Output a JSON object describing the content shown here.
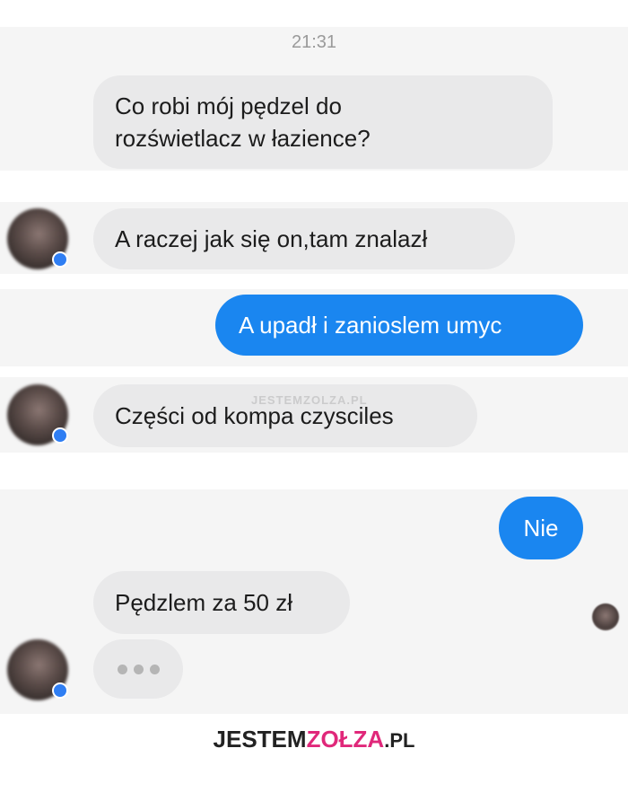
{
  "conversation": {
    "timestamp": "21:31",
    "messages": [
      {
        "from": "me",
        "text": "Co robi mój pędzel do rozświetlacz w łazience?"
      },
      {
        "from": "contact",
        "text": "A raczej jak się on,tam znalazł"
      },
      {
        "from": "me",
        "text": "A upadł i zanioslem umyc"
      },
      {
        "from": "contact",
        "text": "Części od kompa czysciles"
      },
      {
        "from": "me",
        "text": "Nie"
      },
      {
        "from": "contact",
        "text": "Pędzlem za 50 zł"
      }
    ],
    "typing_indicator": "•••"
  },
  "watermark": {
    "text": "JESTEMZOLZA.PL"
  },
  "logo": {
    "part1": "JESTEM",
    "part2": "ZOŁZA",
    "part3": ".PL"
  },
  "colors": {
    "outgoing": "#1a86f0",
    "incoming": "#e9e9ea",
    "band": "#f5f5f5",
    "brand": "#e0287a"
  }
}
